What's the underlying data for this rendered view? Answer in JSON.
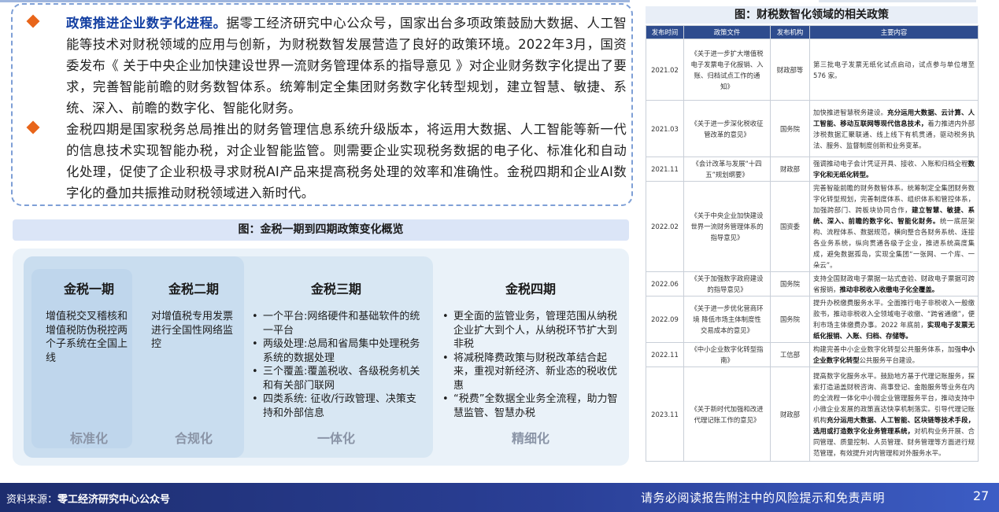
{
  "text_box": {
    "bullets": [
      {
        "lead": "政策推进企业数字化进程。",
        "body": "据零工经济研究中心公众号，国家出台多项政策鼓励大数据、人工智能等技术对财税领域的应用与创新，为财税数智发展营造了良好的政策环境。2022年3月，国资委发布《 关于中央企业加快建设世界一流财务管理体系的指导意见 》对企业财务数字化提出了要求，完善智能前瞻的财务数智体系。统筹制定全集团财务数字化转型规划，建立智慧、敏捷、系统、深入、前瞻的数字化、智能化财务。"
      },
      {
        "lead": "",
        "body": "金税四期是国家税务总局推出的财务管理信息系统升级版本，将运用大数据、人工智能等新一代的信息技术实现智能办税，对企业智能监管。则需要企业实现税务数据的电子化、标准化和自动化处理，促使了企业积极寻求财税AI产品来提高税务处理的效率和准确性。金税四期和企业AI数字化的叠加共振推动财税领域进入新时代。"
      }
    ]
  },
  "diagram": {
    "title": "图：金税一期到四期政策变化概览",
    "phases": [
      {
        "name": "金税一期",
        "desc": "增值税交叉稽核和增值税防伪税控两个子系统在全国上线",
        "items": [],
        "tag": "标准化"
      },
      {
        "name": "金税二期",
        "desc": "对增值税专用发票进行全国性网络监控",
        "items": [],
        "tag": "合规化"
      },
      {
        "name": "金税三期",
        "desc": "",
        "items": [
          "一个平台:网络硬件和基础软件的统一平台",
          "两级处理:总局和省局集中处理税务系统的数据处理",
          "三个覆盖:覆盖税收、各级税务机关和有关部门联网",
          "四类系统: 征收/行政管理、决策支持和外部信息"
        ],
        "tag": "一体化"
      },
      {
        "name": "金税四期",
        "desc": "",
        "items": [
          "更全面的监管业务，管理范围从纳税企业扩大到个人，从纳税环节扩大到非税",
          "将减税降费政策与财税改革结合起来，重视对新经济、新业态的税收优惠",
          "“税费”全数据全业务全流程，助力智慧监管、智慧办税"
        ],
        "tag": "精细化"
      }
    ]
  },
  "policy_table": {
    "title": "图：财税数智化领域的相关政策",
    "headers": [
      "发布时间",
      "政策文件",
      "发布机构",
      "主要内容"
    ],
    "rows": [
      {
        "date": "2021.02",
        "doc": "《关于进一步扩大增值税电子发票电子化报销、入账、归档试点工作的通知》",
        "org": "财政部等",
        "content": [
          {
            "t": "第三批电子发票无纸化试点启动，试点参与单位增至 576 家。",
            "b": false
          }
        ]
      },
      {
        "date": "2021.03",
        "doc": "《关于进一步深化税收征管改革的意见》",
        "org": "国务院",
        "content": [
          {
            "t": "加快推进智慧税务建设。",
            "b": false
          },
          {
            "t": "充分运用大数据、云计算、人工智能、移动互联网等现代信息技术，",
            "b": true
          },
          {
            "t": "着力推进内外部涉税数据汇聚联通、线上线下有机贯通，驱动税务执法、服务、监督制度创新和业务变革。",
            "b": false
          }
        ]
      },
      {
        "date": "2021.11",
        "doc": "《会计改革与发展“十四五”规划纲要》",
        "org": "财政部",
        "content": [
          {
            "t": "强调推动电子会计凭证开具、接收、入账和归档全程",
            "b": false
          },
          {
            "t": "数字化和无纸化转型。",
            "b": true
          }
        ]
      },
      {
        "date": "2022.02",
        "doc": "《关于中央企业加快建设世界一流财务管理体系的指导意见》",
        "org": "国资委",
        "content": [
          {
            "t": "完善智能前瞻的财务数智体系。统筹制定全集团财务数字化转型规划，完善制度体系、组织体系和管控体系，加强跨部门、跨板块协同合作，",
            "b": false
          },
          {
            "t": "建立智慧、敏捷、系统、深入、前瞻的数字化、智能化财务。",
            "b": true
          },
          {
            "t": "统一底层架构、流程体系、数据规范，横向整合各财务系统、连接各业务系统，纵向贯通各级子企业，推进系统高度集成，避免数据孤岛，实现全集团“一张网、一个库、一朵云”。",
            "b": false
          }
        ]
      },
      {
        "date": "2022.06",
        "doc": "《关于加强数字政府建设的指导意见》",
        "org": "国务院",
        "content": [
          {
            "t": "支持全国财政电子票据一站式查验、财政电子票据可跨省报销，",
            "b": false
          },
          {
            "t": "推动非税收入收缴电子化全覆盖。",
            "b": true
          }
        ]
      },
      {
        "date": "2022.09",
        "doc": "《关于进一步优化营商环境 降低市场主体制度性交易成本的意见》",
        "org": "国务院",
        "content": [
          {
            "t": "提升办税缴费服务水平。全面推行电子非税收入一般缴款书，推动非税收入全领域电子收缴、“跨省通缴”，便利市场主体缴费办事。2022 年底前，",
            "b": false
          },
          {
            "t": "实现电子发票无纸化报销、入账、归档、存储等。",
            "b": true
          }
        ]
      },
      {
        "date": "2022.11",
        "doc": "《中小企业数字化转型指南》",
        "org": "工信部",
        "content": [
          {
            "t": "构建完善中小企业数字化转型公共服务体系，加强",
            "b": false
          },
          {
            "t": "中小企业数字化转型",
            "b": true
          },
          {
            "t": "公共服务平台建设。",
            "b": false
          }
        ]
      },
      {
        "date": "2023.11",
        "doc": "《关于新时代加强和改进代理记账工作的意见》",
        "org": "财政部",
        "content": [
          {
            "t": "提高数字化服务水平。鼓励地方基于代理记账服务，探索打造涵盖财税咨询、商事登记、金融服务等业务在内的全流程一体化中小微企业管理服务平台，推动支持中小微企业发展的政策直达快享机制落实。引导代理记账机构",
            "b": false
          },
          {
            "t": "充分运用大数据、人工智能、区块链等技术手段，选用或打造数字化业务管理系统，",
            "b": true
          },
          {
            "t": "对机构业务开展、合同管理、质量控制、人员管理、财务管理等方面进行规范管理，有效提升对内管理和对外服务水平。",
            "b": false
          }
        ]
      }
    ]
  },
  "footer": {
    "source_label": "资料来源：",
    "source_value": "零工经济研究中心公众号",
    "notice": "请务必阅读报告附注中的风险提示和免责声明",
    "page": "27"
  },
  "colors": {
    "accent_blue": "#123ea1",
    "diamond_orange": "#e8651a",
    "table_header": "#2e4c8e",
    "footer_bg": "#2a3f96"
  }
}
